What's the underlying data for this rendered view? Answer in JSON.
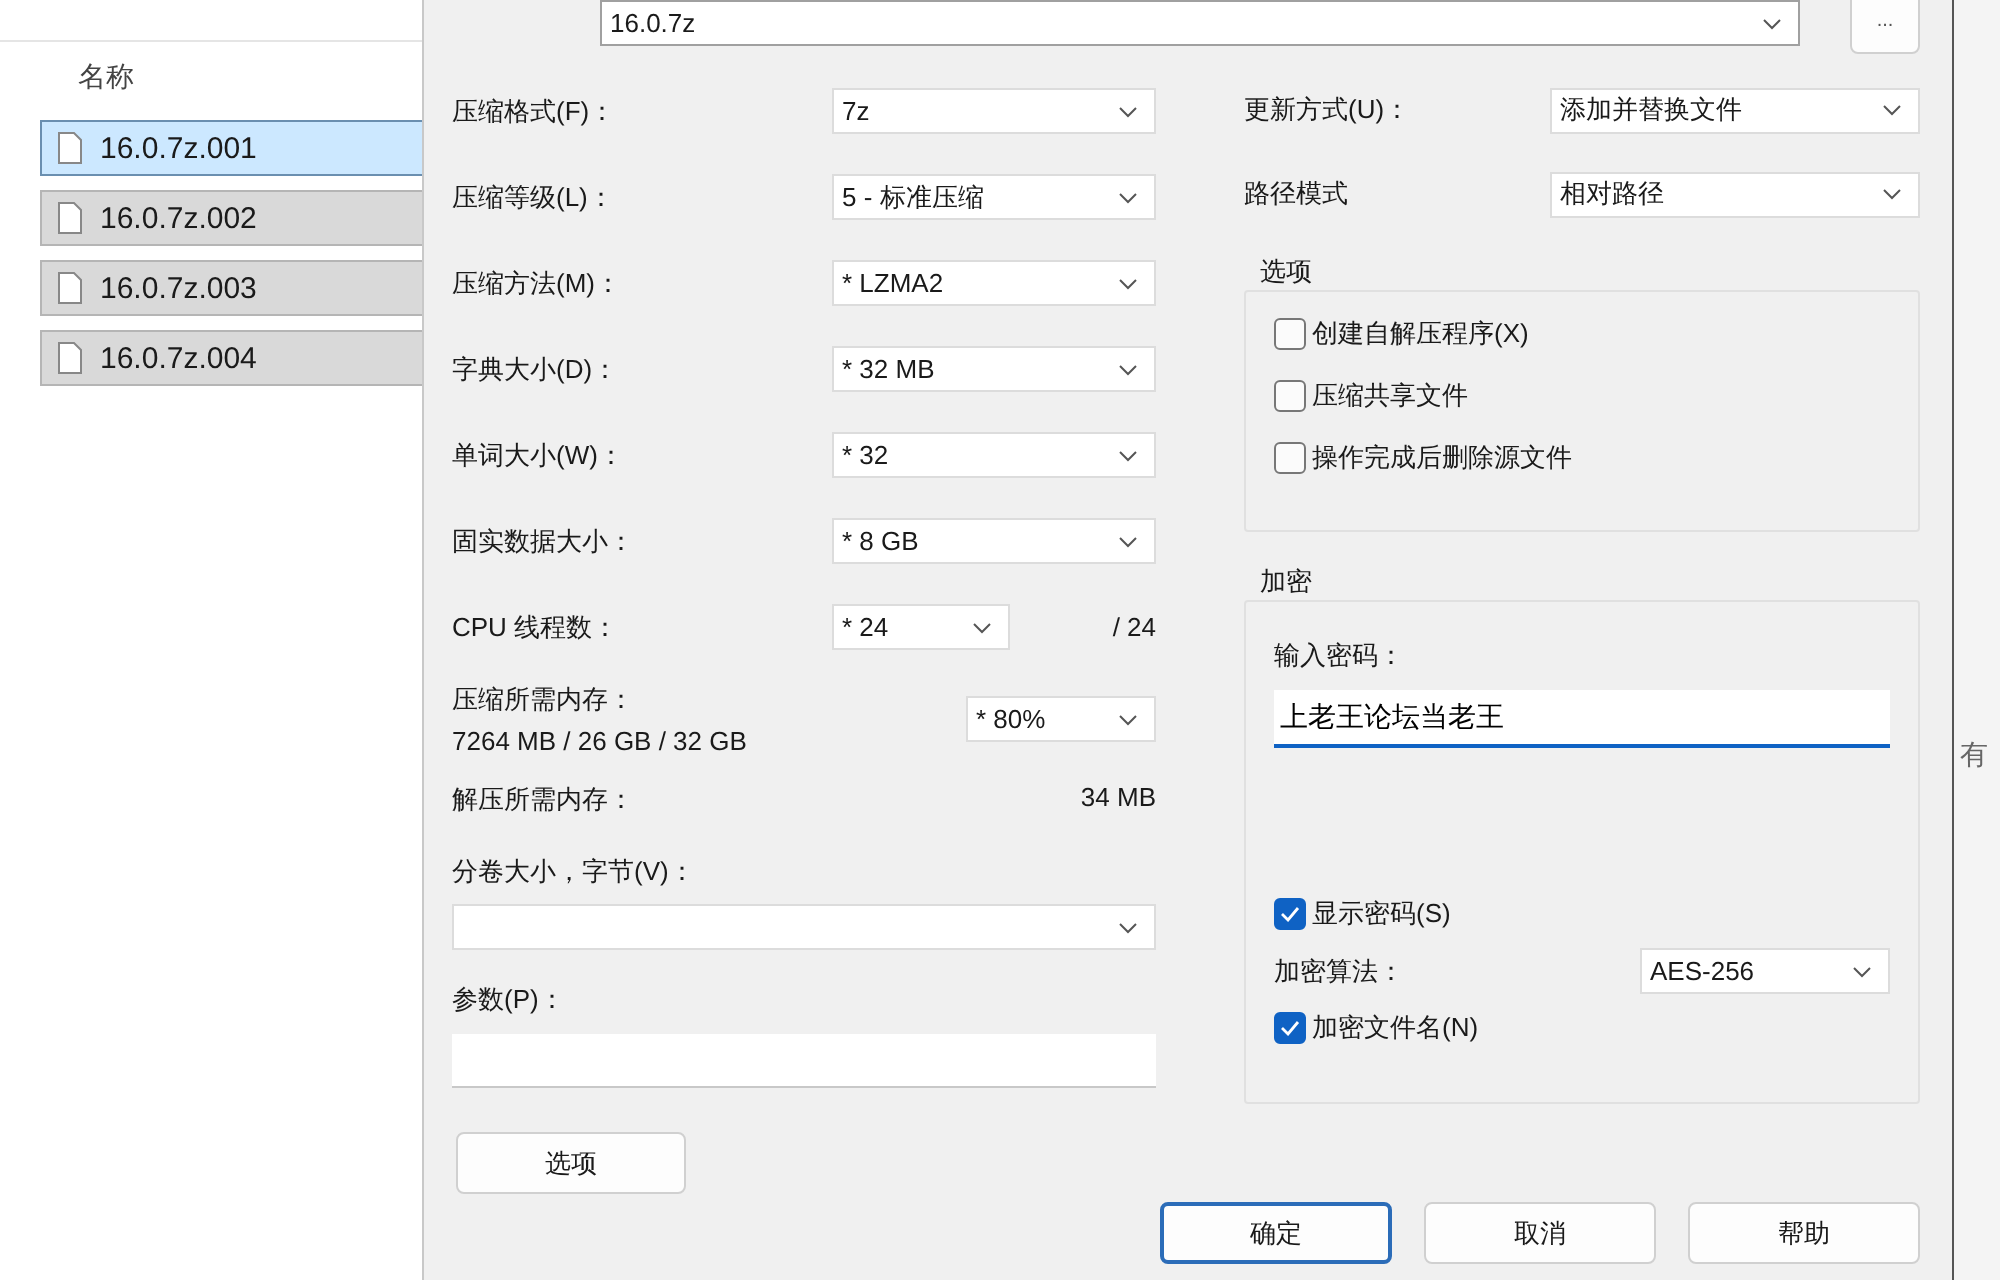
{
  "explorer": {
    "column_header": "名称",
    "files": [
      {
        "name": "16.0.7z.001",
        "selected": true,
        "focused": true
      },
      {
        "name": "16.0.7z.002",
        "selected": true,
        "focused": false
      },
      {
        "name": "16.0.7z.003",
        "selected": true,
        "focused": false
      },
      {
        "name": "16.0.7z.004",
        "selected": true,
        "focused": false
      }
    ]
  },
  "dialog": {
    "archive": {
      "value": "16.0.7z",
      "browse_button": "..."
    },
    "left_fields": [
      {
        "label": "压缩格式(F)：",
        "value": "7z"
      },
      {
        "label": "压缩等级(L)：",
        "value": "5 - 标准压缩"
      },
      {
        "label": "压缩方法(M)：",
        "value": "* LZMA2"
      },
      {
        "label": "字典大小(D)：",
        "value": "* 32 MB"
      },
      {
        "label": "单词大小(W)：",
        "value": "* 32"
      },
      {
        "label": "固实数据大小：",
        "value": "* 8 GB"
      }
    ],
    "threads": {
      "label": "CPU 线程数：",
      "value": "* 24",
      "max": "/ 24"
    },
    "memory": {
      "label": "压缩所需内存：",
      "detail": "7264 MB / 26 GB / 32 GB",
      "value": "* 80%"
    },
    "decompress_memory": {
      "label": "解压所需内存：",
      "value": "34 MB"
    },
    "volume": {
      "label": "分卷大小，字节(V)："
    },
    "parameters": {
      "label": "参数(P)："
    },
    "options_button": "选项",
    "right_fields": [
      {
        "label": "更新方式(U)：",
        "value": "添加并替换文件"
      },
      {
        "label": "路径模式",
        "value": "相对路径"
      }
    ],
    "options_group": {
      "title": "选项",
      "items": [
        {
          "label": "创建自解压程序(X)",
          "checked": false
        },
        {
          "label": "压缩共享文件",
          "checked": false
        },
        {
          "label": "操作完成后删除源文件",
          "checked": false
        }
      ]
    },
    "encryption": {
      "title": "加密",
      "password_label": "输入密码：",
      "password": "上老王论坛当老王",
      "show_password": {
        "label": "显示密码(S)",
        "checked": true
      },
      "method_label": "加密算法：",
      "method": "AES-256",
      "encrypt_names": {
        "label": "加密文件名(N)",
        "checked": true
      }
    },
    "buttons": [
      {
        "label": "确定",
        "default": true
      },
      {
        "label": "取消",
        "default": false
      },
      {
        "label": "帮助",
        "default": false
      }
    ]
  },
  "background_text": "有"
}
